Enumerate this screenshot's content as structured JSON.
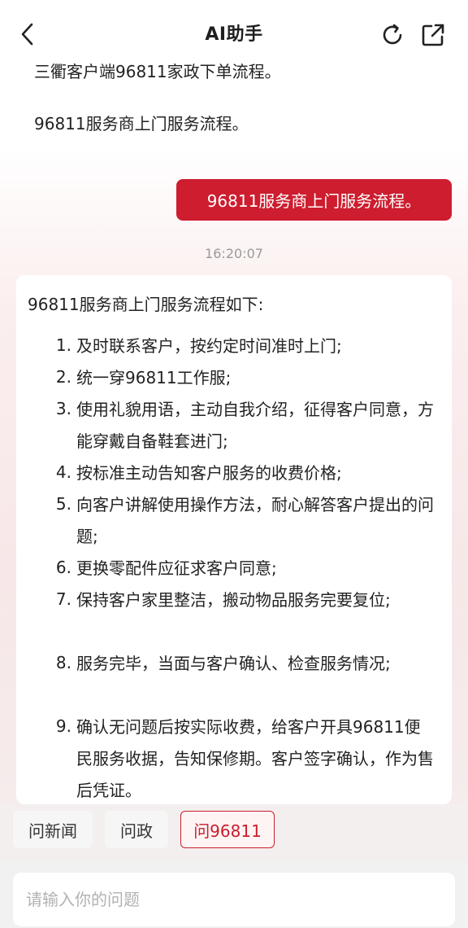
{
  "header": {
    "title": "AI助手",
    "back_icon": "chevron-left-icon",
    "refresh_icon": "refresh-icon",
    "share_icon": "share-icon"
  },
  "messages": {
    "previous_lines": [
      "三衢客户端96811家政下单流程。",
      "96811服务商上门服务流程。"
    ],
    "user_question": "96811服务商上门服务流程。",
    "timestamp": "16:20:07",
    "answer": {
      "intro": "96811服务商上门服务流程如下:",
      "items": [
        {
          "num": "1.",
          "text": "及时联系客户，按约定时间准时上门;"
        },
        {
          "num": "2.",
          "text": "统一穿96811工作服;"
        },
        {
          "num": "3.",
          "text": "使用礼貌用语，主动自我介绍，征得客户同意，方能穿戴自备鞋套进门;"
        },
        {
          "num": "4.",
          "text": "按标准主动告知客户服务的收费价格;"
        },
        {
          "num": "5.",
          "text": "向客户讲解使用操作方法，耐心解答客户提出的问题;"
        },
        {
          "num": "6.",
          "text": "更换零配件应征求客户同意;"
        },
        {
          "num": "7.",
          "text": "保持客户家里整洁，搬动物品服务完要复位;"
        },
        {
          "num": "8.",
          "text": "服务完毕，当面与客户确认、检查服务情况;"
        },
        {
          "num": "9.",
          "text": "确认无问题后按实际收费，给客户开具96811便民服务收据，告知保修期。客户签字确认，作为售后凭证。"
        }
      ]
    }
  },
  "quick_chips": [
    {
      "label": "问新闻",
      "active": false
    },
    {
      "label": "问政",
      "active": false
    },
    {
      "label": "问96811",
      "active": true
    }
  ],
  "input": {
    "placeholder": "请输入你的问题",
    "value": ""
  },
  "colors": {
    "accent": "#cd1d2f",
    "background_tint": "#f7e7e8"
  }
}
